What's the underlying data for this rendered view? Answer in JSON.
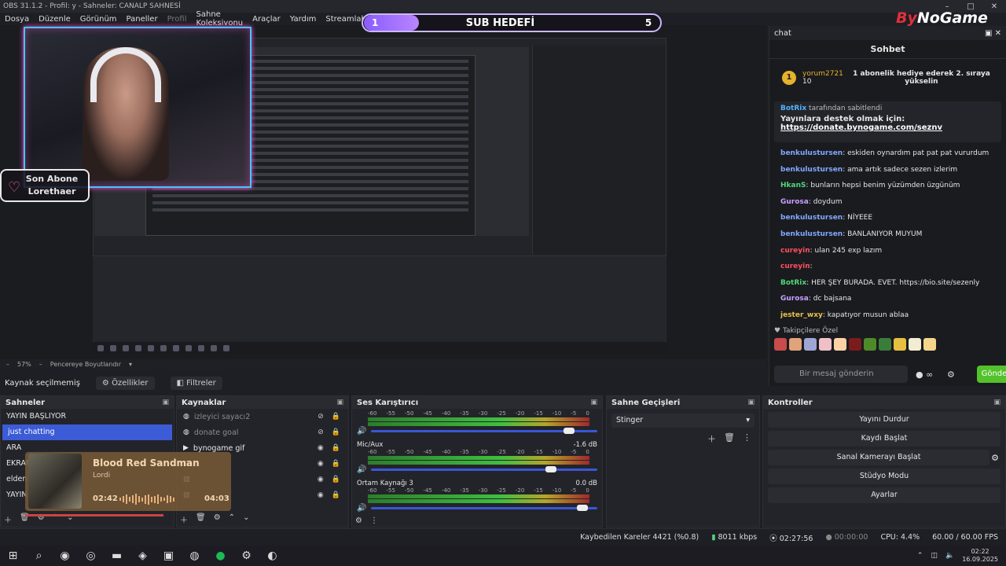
{
  "window": {
    "title": "OBS 31.1.2 - Profil: y - Sahneler: CANALP SAHNESİ"
  },
  "menu": {
    "items": [
      "Dosya",
      "Düzenle",
      "Görünüm",
      "Paneller",
      "Profil",
      "Sahne Koleksiyonu",
      "Araçlar",
      "Yardım",
      "Streamlabs"
    ]
  },
  "overlay": {
    "sub_goal": {
      "current": "1",
      "title": "SUB HEDEFİ",
      "target": "5"
    },
    "logo": {
      "brand_a": "By",
      "brand_b": "NoGame"
    },
    "last_sub": {
      "title": "Son Abone",
      "name": "Lorethaer"
    }
  },
  "zoom": {
    "level": "57%",
    "fit": "Pencereye Boyutlandır"
  },
  "source_bar": {
    "status": "Kaynak seçilmemiş",
    "properties": "Özellikler",
    "filters": "Filtreler"
  },
  "chat": {
    "dock_title": "chat",
    "header": "Sohbet",
    "gift": {
      "user": "yorum2721",
      "count": "10",
      "text": "1 abonelik hediye ederek 2. sıraya yükselin"
    },
    "pinned": {
      "by_user": "BotRix",
      "by_text": "tarafından sabitlendi",
      "title": "Yayınlara destek olmak için:",
      "link": "https://donate.bynogame.com/seznv"
    },
    "messages": [
      {
        "user": "benkulustursen",
        "text": ": eskiden oynardım pat pat pat vururdum",
        "color": "blue"
      },
      {
        "user": "benkulustursen",
        "text": ": ama artık sadece sezen izlerim",
        "color": "blue"
      },
      {
        "user": "HkanS",
        "text": ": bunların hepsi benim yüzümden üzgünüm",
        "color": "green"
      },
      {
        "user": "Gurosa",
        "text": ": doydum",
        "color": "purple"
      },
      {
        "user": "benkulustursen",
        "text": ": NİYEEE",
        "color": "blue"
      },
      {
        "user": "benkulustursen",
        "text": ": BANLANIYOR MUYUM",
        "color": "blue"
      },
      {
        "user": "cureyin",
        "text": ": ulan 245 exp lazım",
        "color": "red"
      },
      {
        "user": "cureyin",
        "text": ":",
        "color": "red"
      },
      {
        "user": "BotRix",
        "text": ": HER ŞEY BURADA. EVET. https://bio.site/sezenly",
        "color": "green"
      },
      {
        "user": "Gurosa",
        "text": ": dc bajsana",
        "color": "purple"
      },
      {
        "user": "jester_wxy",
        "text": ": kapatıyor musun ablaa",
        "color": "gold"
      }
    ],
    "followers_label": "Takipçilere Özel",
    "input_placeholder": "Bir mesaj gönderin",
    "send": "Gönder",
    "emote_colors": [
      "#c94b4b",
      "#e0a37a",
      "#9fa6d6",
      "#f0c0c8",
      "#ffd2a6",
      "#7a1c1c",
      "#4f8a2a",
      "#3a7d3a",
      "#e8c040",
      "#f2ecd2",
      "#f6d58a"
    ]
  },
  "scenes": {
    "title": "Sahneler",
    "items": [
      "YAYIN BAŞLIYOR",
      "just chatting",
      "ARA",
      "EKRAN",
      "elden",
      "YAYIN"
    ],
    "selected": 1
  },
  "sources": {
    "title": "Kaynaklar",
    "items": [
      {
        "name": "izleyici sayacı2",
        "dim": true,
        "icon": "globe-icon"
      },
      {
        "name": "donate goal",
        "dim": true,
        "icon": "globe-icon"
      },
      {
        "name": "bynogame gif",
        "dim": false,
        "icon": "play-icon"
      },
      {
        "name": "",
        "dim": false,
        "icon": "image-icon"
      },
      {
        "name": "",
        "dim": false,
        "icon": "image-icon"
      },
      {
        "name": "",
        "dim": false,
        "icon": "image-icon"
      }
    ]
  },
  "mixer": {
    "title": "Ses Karıştırıcı",
    "ticks": [
      "-60",
      "-55",
      "-50",
      "-45",
      "-40",
      "-35",
      "-30",
      "-25",
      "-20",
      "-15",
      "-10",
      "-5",
      "0"
    ],
    "channels": [
      {
        "name": "",
        "db": "",
        "volume": 0.9
      },
      {
        "name": "Mic/Aux",
        "db": "-1.6 dB",
        "volume": 0.82
      },
      {
        "name": "Ortam Kaynağı 3",
        "db": "0.0 dB",
        "volume": 0.96
      }
    ]
  },
  "transitions": {
    "title": "Sahne Geçişleri",
    "selected": "Stinger"
  },
  "controls": {
    "title": "Kontroller",
    "buttons": [
      "Yayını Durdur",
      "Kaydı Başlat",
      "Sanal Kamerayı Başlat",
      "Stüdyo Modu",
      "Ayarlar"
    ]
  },
  "now_playing": {
    "title": "Blood Red Sandman",
    "artist": "Lordi",
    "elapsed": "02:42",
    "total": "04:03",
    "progress": 0.67
  },
  "status": {
    "dropped": "Kaybedilen Kareler 4421 (%0.8)",
    "bitrate": "8011 kbps",
    "live_time": "02:27:56",
    "rec_time": "00:00:00",
    "cpu": "CPU: 4.4%",
    "fps": "60.00 / 60.00 FPS"
  },
  "taskbar": {
    "time": "02:22",
    "date": "16.09.2025"
  }
}
